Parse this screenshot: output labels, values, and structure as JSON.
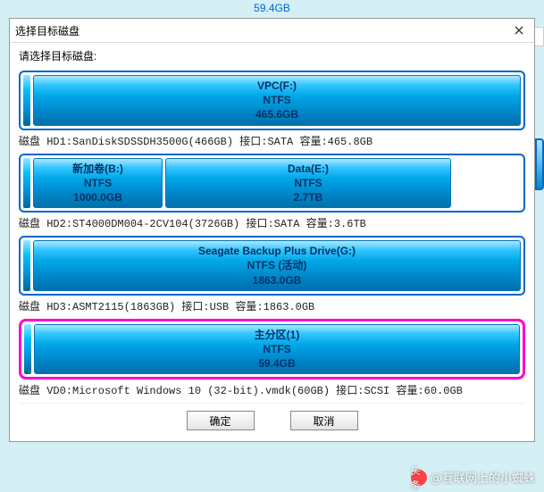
{
  "topTitle": "59.4GB",
  "dialog": {
    "title": "选择目标磁盘",
    "instruction": "请选择目标磁盘:",
    "disks": [
      {
        "partitions": [
          {
            "name": "VPC(F:)",
            "fs": "NTFS",
            "size": "465.6GB",
            "cls": "flex1"
          }
        ],
        "info": "磁盘 HD1:SanDiskSDSSDH3500G(466GB)  接口:SATA  容量:465.8GB"
      },
      {
        "partitions": [
          {
            "name": "新加卷(B:)",
            "fs": "NTFS",
            "size": "1000.0GB",
            "cls": "w140"
          },
          {
            "name": "Data(E:)",
            "fs": "NTFS",
            "size": "2.7TB",
            "cls": "w310"
          }
        ],
        "info": "磁盘 HD2:ST4000DM004-2CV104(3726GB)  接口:SATA  容量:3.6TB"
      },
      {
        "partitions": [
          {
            "name": "Seagate Backup Plus Drive(G:)",
            "fs": "NTFS (活动)",
            "size": "1863.0GB",
            "cls": "flex1"
          }
        ],
        "info": "磁盘 HD3:ASMT2115(1863GB)  接口:USB  容量:1863.0GB"
      },
      {
        "selected": true,
        "partitions": [
          {
            "name": "主分区(1)",
            "fs": "NTFS",
            "size": "59.4GB",
            "cls": "flex1"
          }
        ],
        "info": "磁盘 VD0:Microsoft Windows 10 (32-bit).vmdk(60GB)  接口:SCSI  容量:60.0GB"
      }
    ],
    "buttons": {
      "ok": "确定",
      "cancel": "取消"
    }
  },
  "watermark": {
    "prefix": "头条",
    "text": "@互联网上的小蜘蛛"
  }
}
